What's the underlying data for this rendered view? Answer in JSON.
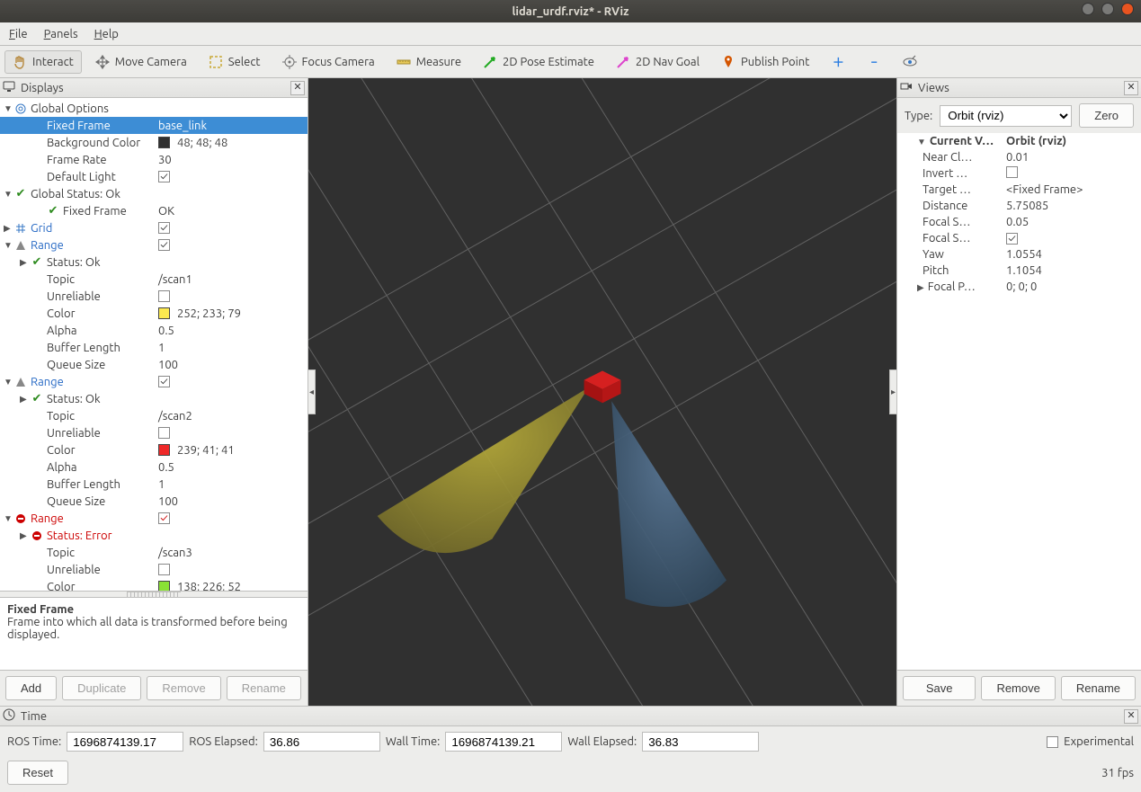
{
  "window": {
    "title": "lidar_urdf.rviz* - RViz"
  },
  "menu": {
    "file_k": "F",
    "file": "ile",
    "panels_k": "P",
    "panels": "anels",
    "help_k": "H",
    "help": "elp"
  },
  "toolbar": {
    "interact": "Interact",
    "move_camera": "Move Camera",
    "select": "Select",
    "focus_camera": "Focus Camera",
    "measure": "Measure",
    "pose_est": "2D Pose Estimate",
    "nav_goal": "2D Nav Goal",
    "pub_point": "Publish Point"
  },
  "displays": {
    "title": "Displays",
    "global_options": "Global Options",
    "fixed_frame_k": "Fixed Frame",
    "fixed_frame_v": "base_link",
    "bg_k": "Background Color",
    "bg_v": "48; 48; 48",
    "fr_k": "Frame Rate",
    "fr_v": "30",
    "dl_k": "Default Light",
    "gs": "Global Status: Ok",
    "gs_ff_k": "Fixed Frame",
    "gs_ff_v": "OK",
    "grid": "Grid",
    "range": "Range",
    "status_ok": "Status: Ok",
    "status_err": "Status: Error",
    "topic_k": "Topic",
    "unreliable_k": "Unreliable",
    "color_k": "Color",
    "alpha_k": "Alpha",
    "buflen_k": "Buffer Length",
    "qs_k": "Queue Size",
    "r1_topic": "/scan1",
    "r1_color": "252; 233; 79",
    "r1_alpha": "0.5",
    "r1_buf": "1",
    "r1_qs": "100",
    "r2_topic": "/scan2",
    "r2_color": "239; 41; 41",
    "r2_alpha": "0.5",
    "r2_buf": "1",
    "r2_qs": "100",
    "r3_topic": "/scan3",
    "r3_color": "138; 226; 52",
    "desc_title": "Fixed Frame",
    "desc_body": "Frame into which all data is transformed before being displayed.",
    "add": "Add",
    "duplicate": "Duplicate",
    "remove": "Remove",
    "rename": "Rename"
  },
  "views": {
    "title": "Views",
    "type_lbl": "Type:",
    "type_val": "Orbit (rviz)",
    "zero": "Zero",
    "cur_view": "Current V…",
    "cur_view_v": "Orbit (rviz)",
    "near_k": "Near Cl…",
    "near_v": "0.01",
    "inv_k": "Invert …",
    "target_k": "Target …",
    "target_v": "<Fixed Frame>",
    "dist_k": "Distance",
    "dist_v": "5.75085",
    "fs1_k": "Focal S…",
    "fs1_v": "0.05",
    "fs2_k": "Focal S…",
    "yaw_k": "Yaw",
    "yaw_v": "1.0554",
    "pitch_k": "Pitch",
    "pitch_v": "1.1054",
    "fp_k": "Focal P…",
    "fp_v": "0; 0; 0",
    "save": "Save",
    "remove": "Remove",
    "rename": "Rename"
  },
  "time": {
    "title": "Time",
    "ros_time_l": "ROS Time:",
    "ros_time_v": "1696874139.17",
    "ros_el_l": "ROS Elapsed:",
    "ros_el_v": "36.86",
    "wall_time_l": "Wall Time:",
    "wall_time_v": "1696874139.21",
    "wall_el_l": "Wall Elapsed:",
    "wall_el_v": "36.83",
    "experimental": "Experimental",
    "reset": "Reset",
    "fps": "31 fps"
  },
  "icons": {
    "plus": "✚",
    "minus": "━",
    "eye": "👁"
  }
}
